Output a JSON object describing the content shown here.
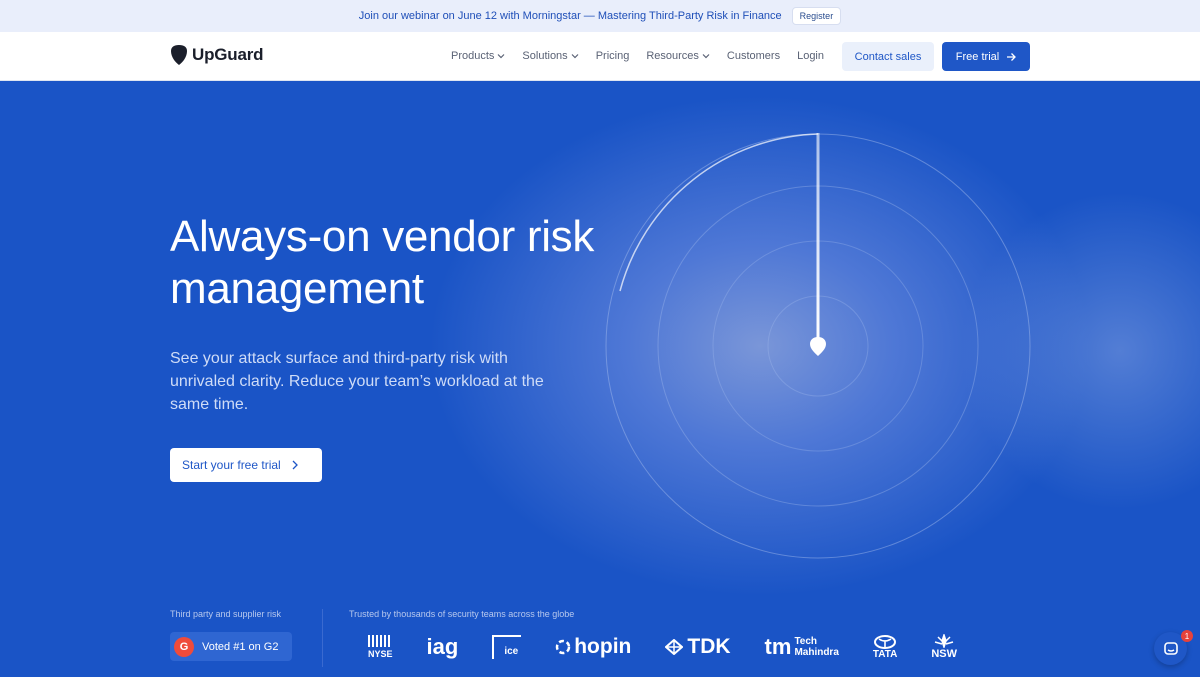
{
  "announcement": {
    "text": "Join our webinar on June 12 with Morningstar — Mastering Third-Party Risk in Finance",
    "register_label": "Register"
  },
  "nav": {
    "brand": "UpGuard",
    "items": [
      {
        "label": "Products",
        "has_dropdown": true
      },
      {
        "label": "Solutions",
        "has_dropdown": true
      },
      {
        "label": "Pricing",
        "has_dropdown": false
      },
      {
        "label": "Resources",
        "has_dropdown": true
      },
      {
        "label": "Customers",
        "has_dropdown": false
      },
      {
        "label": "Login",
        "has_dropdown": false
      }
    ],
    "contact_label": "Contact sales",
    "trial_label": "Free trial"
  },
  "hero": {
    "title": "Always-on vendor risk management",
    "subtitle": "See your attack surface and third-party risk with unrivaled clarity. Reduce your team’s workload at the same time.",
    "cta_label": "Start your free trial"
  },
  "footer_strip": {
    "g2_caption": "Third party and supplier risk",
    "g2_badge_letter": "G",
    "g2_label": "Voted #1 on G2",
    "trusted_caption": "Trusted by thousands of security teams across the globe",
    "logos": {
      "nyse": "NYSE",
      "iag": "iag",
      "ice": "ice",
      "hopin": "hopin",
      "tdk": "TDK",
      "tech_mark": "tm",
      "tech_line1": "Tech",
      "tech_line2": "Mahindra",
      "tata": "TATA",
      "nsw": "NSW"
    }
  },
  "chat": {
    "badge_count": "1"
  },
  "colors": {
    "brand_blue": "#1f57c7",
    "hero_bg": "#1752c4",
    "announce_bg": "#e9eefb"
  }
}
